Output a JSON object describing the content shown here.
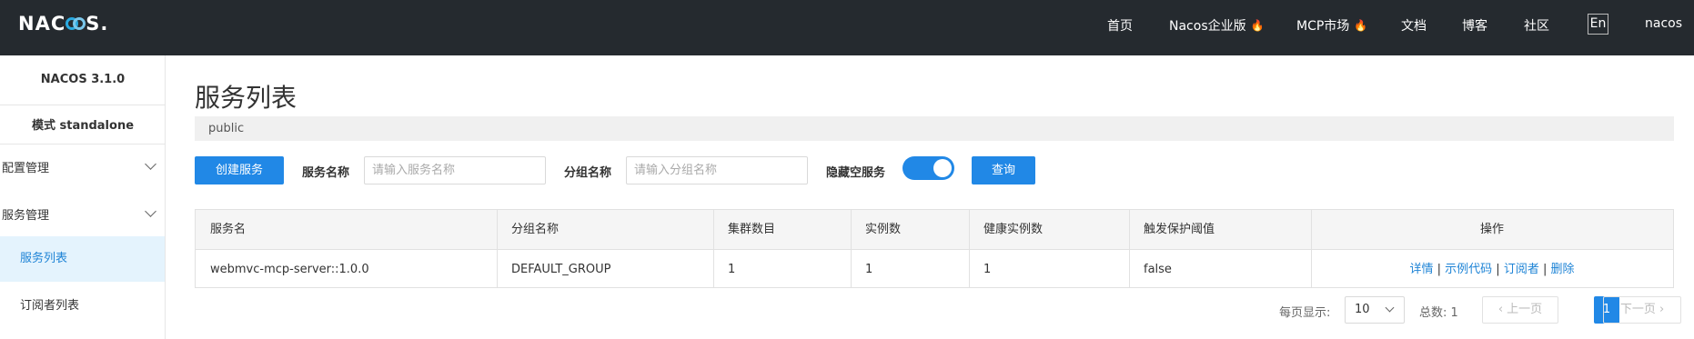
{
  "header": {
    "logo_left": "NAC",
    "logo_right": "S",
    "logo_dot": ".",
    "nav": [
      {
        "label": "首页",
        "hot": false
      },
      {
        "label": "Nacos企业版",
        "hot": true
      },
      {
        "label": "MCP市场",
        "hot": true
      },
      {
        "label": "文档",
        "hot": false
      },
      {
        "label": "博客",
        "hot": false
      },
      {
        "label": "社区",
        "hot": false
      }
    ],
    "lang": "En",
    "user": "nacos",
    "hot_icon": "fire-icon"
  },
  "sidebar": {
    "version": "NACOS 3.1.0",
    "mode": "模式 standalone",
    "groups": [
      {
        "label": "配置管理",
        "icon": "chevron-down-icon"
      },
      {
        "label": "服务管理",
        "icon": "chevron-down-icon"
      }
    ],
    "items": [
      {
        "label": "服务列表",
        "active": true
      },
      {
        "label": "订阅者列表",
        "active": false
      }
    ]
  },
  "main": {
    "title": "服务列表",
    "namespace": "public",
    "create_button": "创建服务",
    "service_name_label": "服务名称",
    "service_name_placeholder": "请输入服务名称",
    "group_name_label": "分组名称",
    "group_name_placeholder": "请输入分组名称",
    "hide_empty_label": "隐藏空服务",
    "hide_empty_on": true,
    "query_button": "查询"
  },
  "table": {
    "columns": [
      "服务名",
      "分组名称",
      "集群数目",
      "实例数",
      "健康实例数",
      "触发保护阈值",
      "操作"
    ],
    "rows": [
      {
        "service": "webmvc-mcp-server::1.0.0",
        "group": "DEFAULT_GROUP",
        "clusters": "1",
        "instances": "1",
        "healthy": "1",
        "threshold": "false",
        "actions": [
          "详情",
          "示例代码",
          "订阅者",
          "删除"
        ],
        "separator": "|"
      }
    ]
  },
  "pagination": {
    "page_size_label": "每页显示:",
    "page_size": "10",
    "total_label": "总数: 1",
    "prev": "上一页",
    "current": "1",
    "next": "下一页"
  },
  "colors": {
    "topbar": "#252a2f",
    "primary": "#2188e6",
    "active_bg": "#e4f3fd",
    "link": "#1f84d6",
    "hot": "#e8482f"
  }
}
